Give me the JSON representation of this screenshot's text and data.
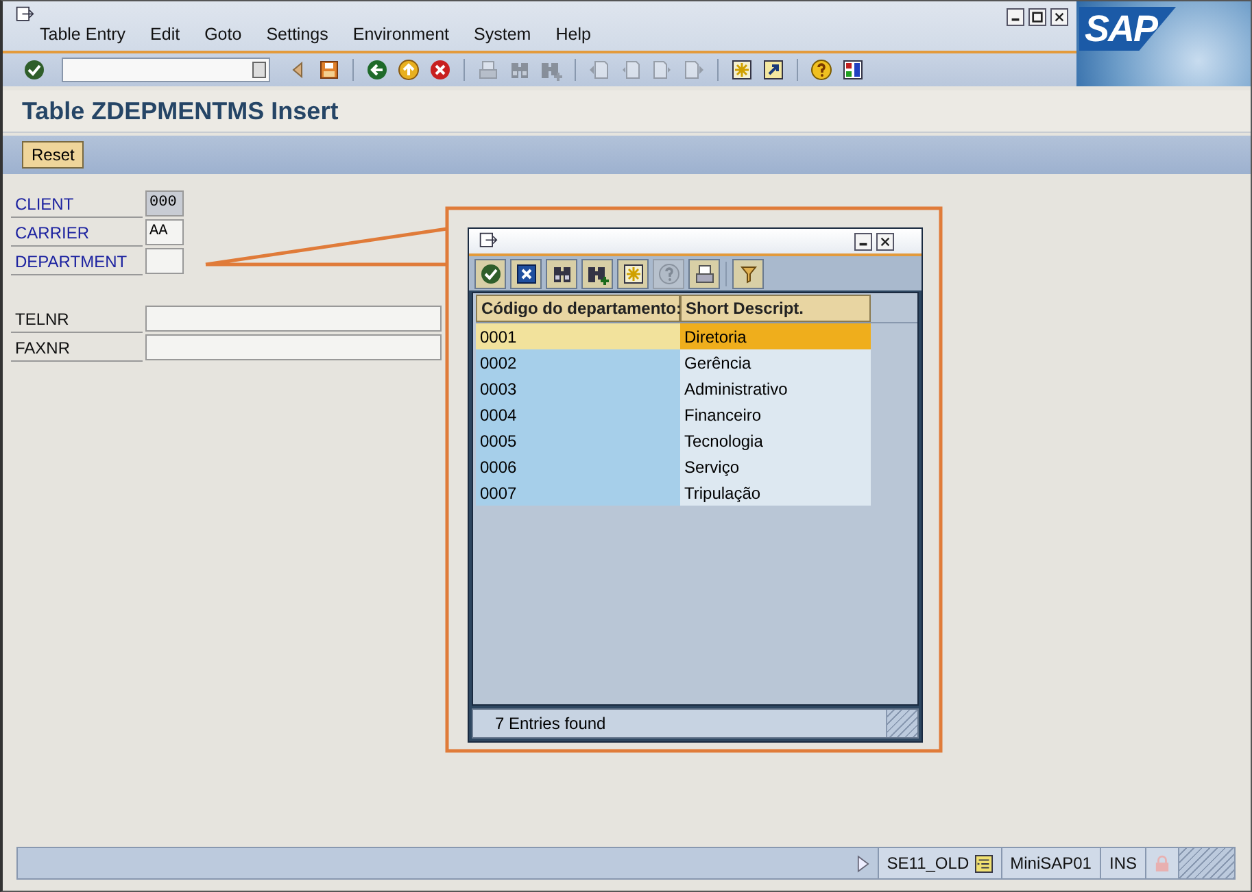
{
  "window": {
    "logo": "SAP"
  },
  "menu": [
    "Table Entry",
    "Edit",
    "Goto",
    "Settings",
    "Environment",
    "System",
    "Help"
  ],
  "toolbar": [
    {
      "kind": "check",
      "disabled": false
    },
    {
      "kind": "field"
    },
    {
      "kind": "triangle",
      "disabled": false
    },
    {
      "kind": "save",
      "disabled": false
    },
    {
      "kind": "separator"
    },
    {
      "kind": "back",
      "disabled": false
    },
    {
      "kind": "exit",
      "disabled": false
    },
    {
      "kind": "cancel",
      "disabled": false
    },
    {
      "kind": "separator"
    },
    {
      "kind": "print",
      "disabled": true
    },
    {
      "kind": "find",
      "disabled": true
    },
    {
      "kind": "find-next",
      "disabled": true
    },
    {
      "kind": "separator"
    },
    {
      "kind": "first-page",
      "disabled": true
    },
    {
      "kind": "previous-page",
      "disabled": true
    },
    {
      "kind": "next-page",
      "disabled": true
    },
    {
      "kind": "last-page",
      "disabled": true
    },
    {
      "kind": "separator"
    },
    {
      "kind": "new-session",
      "disabled": false
    },
    {
      "kind": "shortcut",
      "disabled": false
    },
    {
      "kind": "separator"
    },
    {
      "kind": "help",
      "disabled": false
    },
    {
      "kind": "layout",
      "disabled": false
    }
  ],
  "title": "Table ZDEPMENTMS Insert",
  "app_toolbar": [
    {
      "label": "Reset"
    }
  ],
  "fields": [
    {
      "label": "CLIENT",
      "value": "000",
      "kind": "key",
      "disabled": true
    },
    {
      "label": "CARRIER",
      "value": "AA",
      "kind": "key",
      "disabled": false
    },
    {
      "label": "DEPARTMENT",
      "kind": "key",
      "disabled": false
    },
    {
      "label": "TELNR",
      "kind": "data",
      "disabled": false
    },
    {
      "label": "FAXNR",
      "kind": "data",
      "disabled": false
    }
  ],
  "popup": {
    "toolbar": [
      {
        "kind": "check",
        "disabled": false
      },
      {
        "kind": "cancel-square",
        "disabled": false
      },
      {
        "kind": "find",
        "disabled": false
      },
      {
        "kind": "find-next",
        "disabled": false
      },
      {
        "kind": "new-session",
        "disabled": false
      },
      {
        "kind": "help",
        "disabled": true
      },
      {
        "kind": "print",
        "disabled": false
      },
      {
        "kind": "separator"
      },
      {
        "kind": "filter",
        "disabled": false
      }
    ],
    "columns": [
      "Código do departamento:",
      "Short Descript."
    ],
    "rows": [
      {
        "code": "0001",
        "description": "Diretoria",
        "selected": true
      },
      {
        "code": "0002",
        "description": "Gerência",
        "selected": false
      },
      {
        "code": "0003",
        "description": "Administrativo",
        "selected": false
      },
      {
        "code": "0004",
        "description": "Financeiro",
        "selected": false
      },
      {
        "code": "0005",
        "description": "Tecnologia",
        "selected": false
      },
      {
        "code": "0006",
        "description": "Serviço",
        "selected": false
      },
      {
        "code": "0007",
        "description": "Tripulação",
        "selected": false
      }
    ],
    "status": "7 Entries found"
  },
  "status_bar": {
    "transaction": "SE11_OLD",
    "system": "MiniSAP01",
    "mode": "INS"
  }
}
